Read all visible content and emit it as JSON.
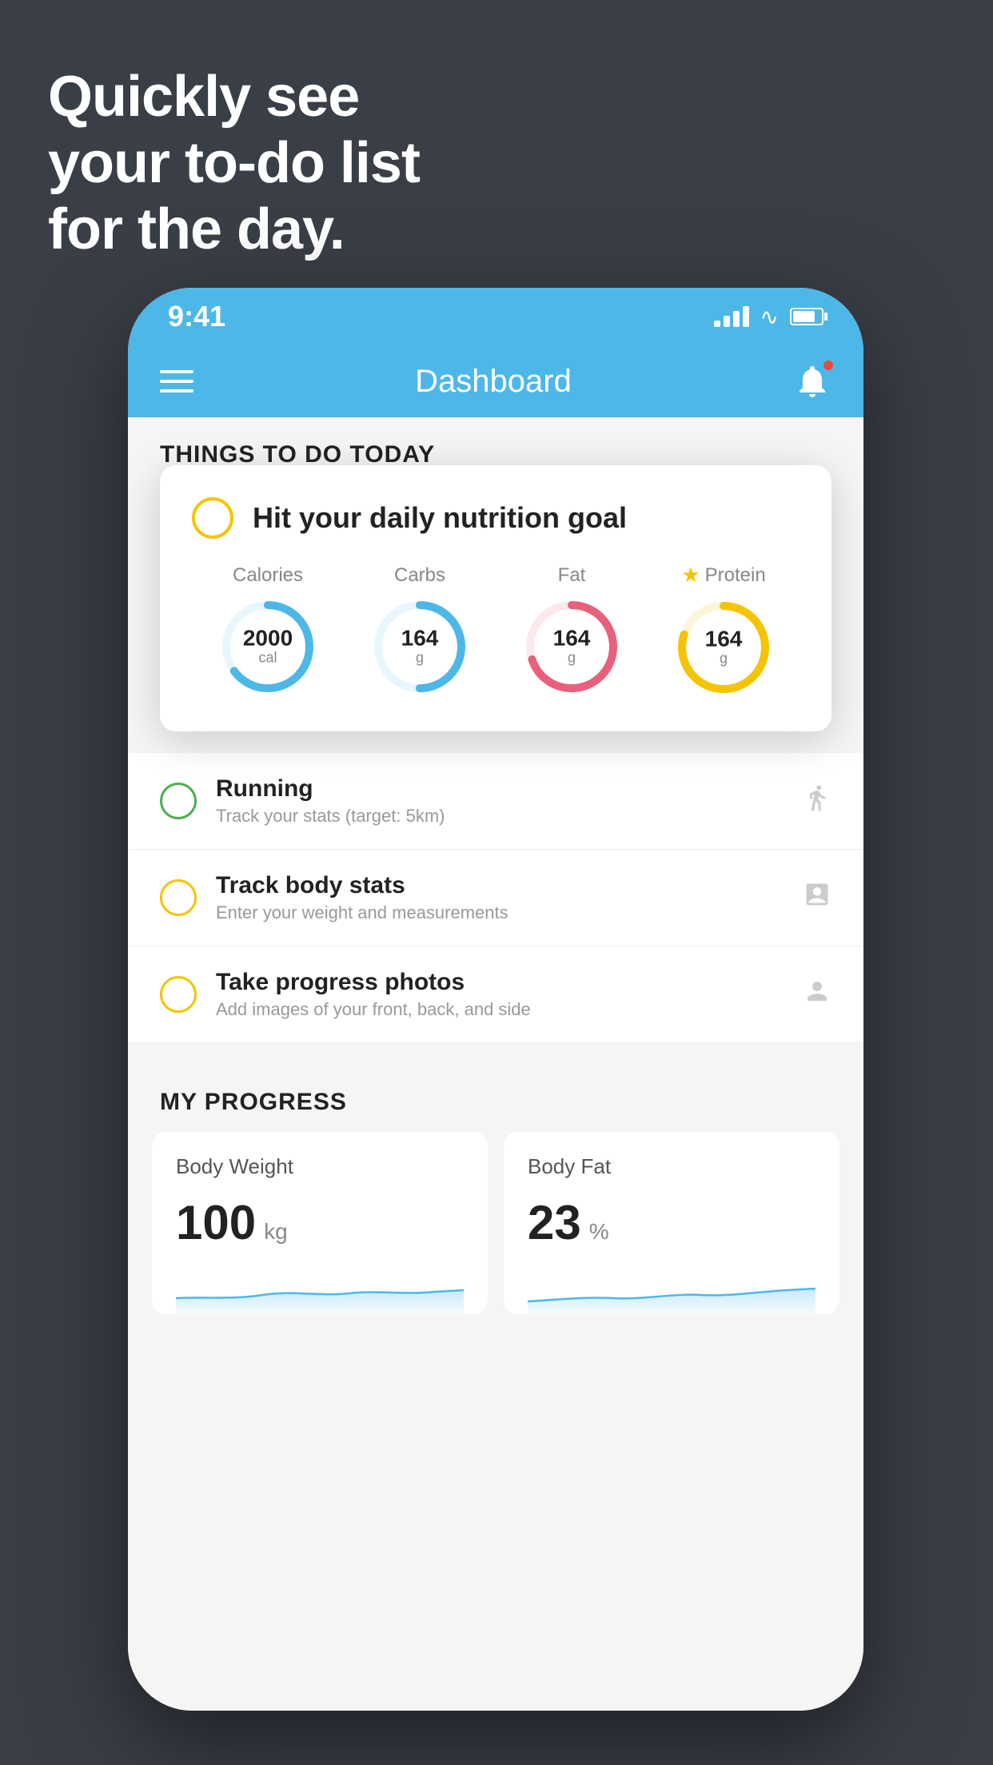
{
  "headline": {
    "line1": "Quickly see",
    "line2": "your to-do list",
    "line3": "for the day."
  },
  "status_bar": {
    "time": "9:41"
  },
  "nav": {
    "title": "Dashboard"
  },
  "things_section": {
    "header": "THINGS TO DO TODAY"
  },
  "nutrition_card": {
    "title": "Hit your daily nutrition goal",
    "calories": {
      "label": "Calories",
      "value": "2000",
      "unit": "cal",
      "color": "#4db8e8",
      "pct": 0.65
    },
    "carbs": {
      "label": "Carbs",
      "value": "164",
      "unit": "g",
      "color": "#4db8e8",
      "pct": 0.5
    },
    "fat": {
      "label": "Fat",
      "value": "164",
      "unit": "g",
      "color": "#e8607a",
      "pct": 0.7
    },
    "protein": {
      "label": "Protein",
      "value": "164",
      "unit": "g",
      "color": "#f5c400",
      "pct": 0.8
    }
  },
  "todo_items": [
    {
      "title": "Running",
      "subtitle": "Track your stats (target: 5km)",
      "circle_color": "green",
      "icon": "👟"
    },
    {
      "title": "Track body stats",
      "subtitle": "Enter your weight and measurements",
      "circle_color": "yellow",
      "icon": "⚖"
    },
    {
      "title": "Take progress photos",
      "subtitle": "Add images of your front, back, and side",
      "circle_color": "yellow",
      "icon": "👤"
    }
  ],
  "progress_section": {
    "header": "MY PROGRESS",
    "body_weight": {
      "title": "Body Weight",
      "value": "100",
      "unit": "kg"
    },
    "body_fat": {
      "title": "Body Fat",
      "value": "23",
      "unit": "%"
    }
  }
}
